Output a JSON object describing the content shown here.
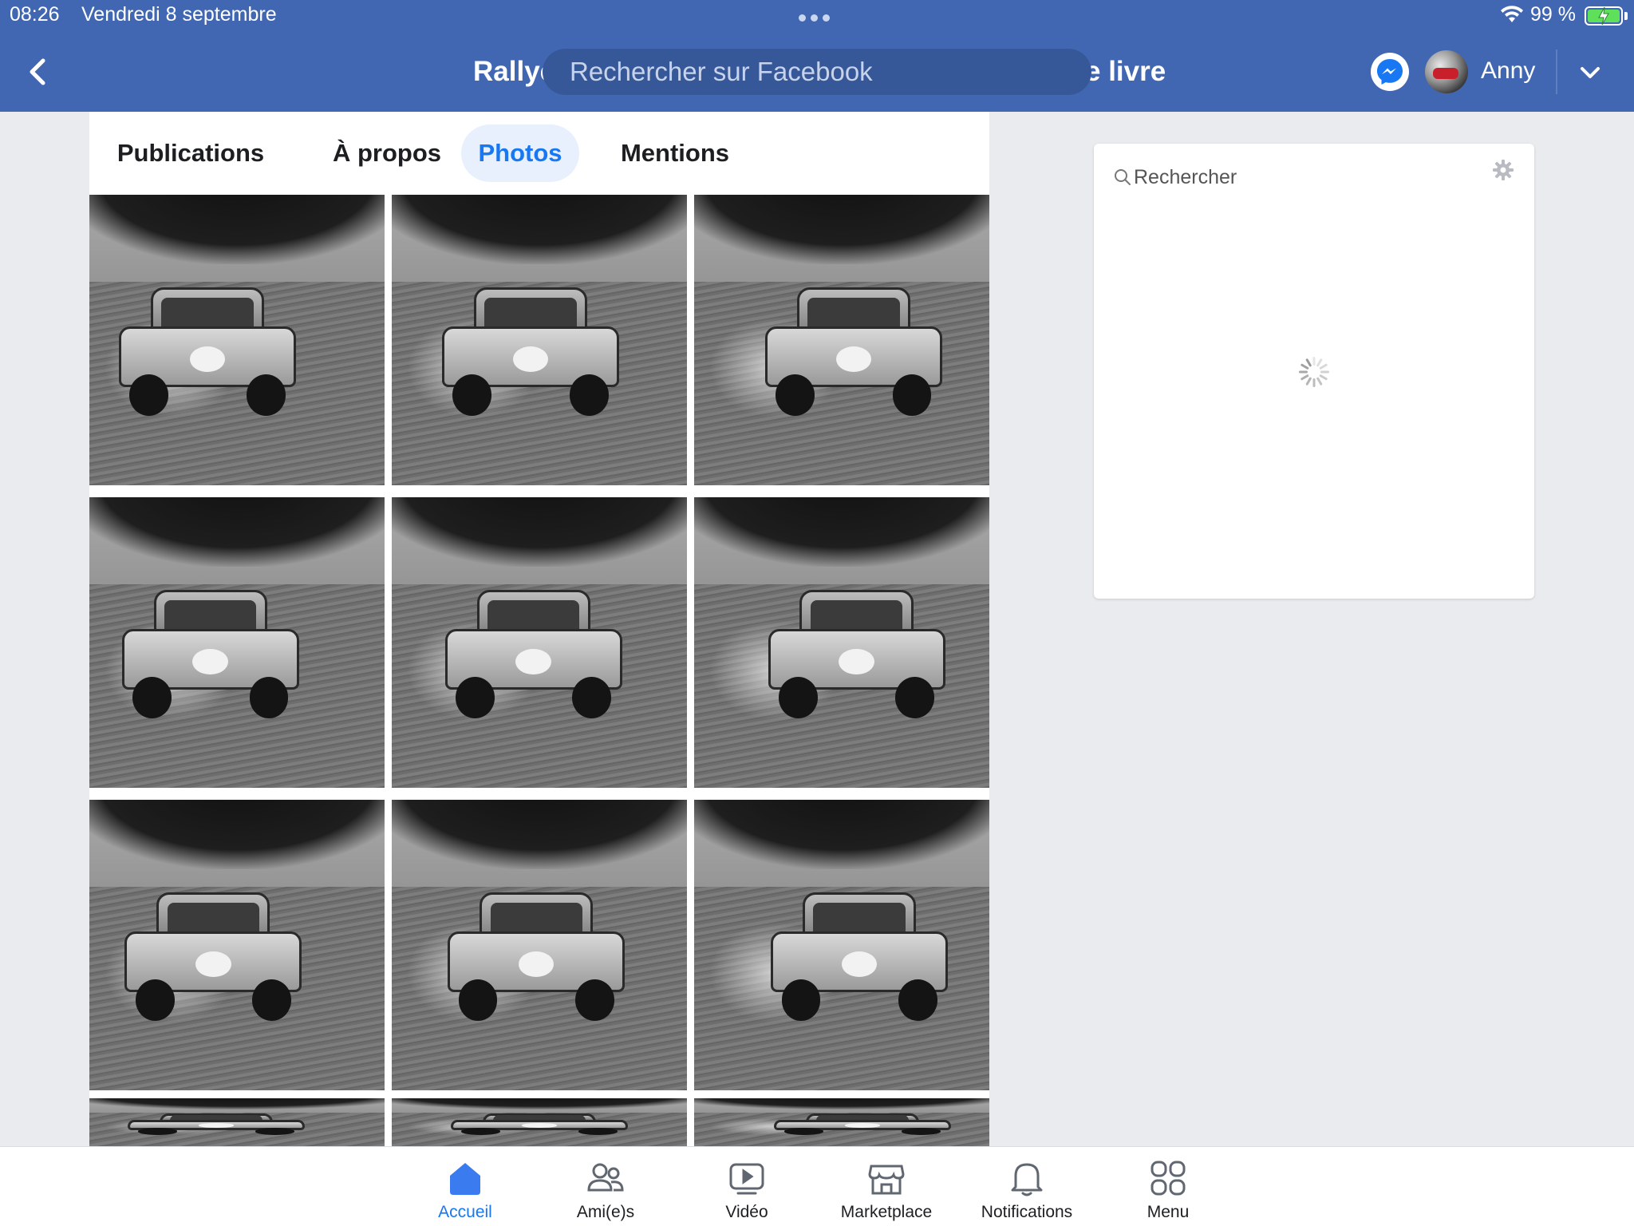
{
  "status_bar": {
    "time": "08:26",
    "date": "Vendredi 8 septembre",
    "battery": "99 %",
    "battery_level": 0.99,
    "wifi_icon": "wifi-icon",
    "battery_icon": "battery-charging-icon"
  },
  "header": {
    "back_icon": "chevron-left-icon",
    "title_left": "Rallye",
    "title_right": "e livre",
    "search_placeholder": "Rechercher sur Facebook",
    "messenger_icon": "messenger-icon",
    "user_name": "Anny",
    "dropdown_icon": "chevron-down-icon",
    "bar_color": "#4267b2"
  },
  "tabs": [
    {
      "label": "Publications",
      "active": false
    },
    {
      "label": "À propos",
      "active": false
    },
    {
      "label": "Photos",
      "active": true
    },
    {
      "label": "Mentions",
      "active": false
    }
  ],
  "side_panel": {
    "search_placeholder": "Rechercher",
    "search_icon": "search-icon",
    "settings_icon": "gear-icon",
    "loading_icon": "spinner-icon"
  },
  "bottom_nav": [
    {
      "label": "Accueil",
      "icon": "home-icon",
      "active": true
    },
    {
      "label": "Ami(e)s",
      "icon": "friends-icon",
      "active": false
    },
    {
      "label": "Vidéo",
      "icon": "video-icon",
      "active": false
    },
    {
      "label": "Marketplace",
      "icon": "marketplace-icon",
      "active": false
    },
    {
      "label": "Notifications",
      "icon": "bell-icon",
      "active": false
    },
    {
      "label": "Menu",
      "icon": "grid-icon",
      "active": false
    }
  ],
  "colors": {
    "accent": "#1877f2",
    "active_tab_bg": "#e7f0fc"
  }
}
